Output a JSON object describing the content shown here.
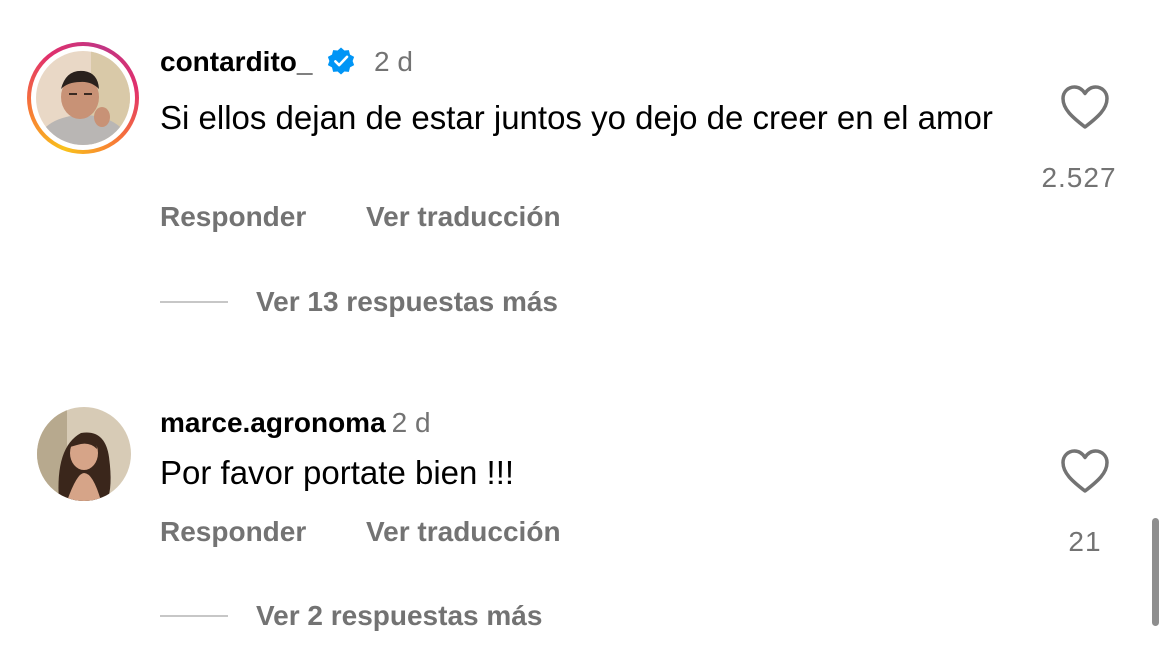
{
  "comments": [
    {
      "username": "contardito_",
      "verified": true,
      "time": "2 d",
      "text": "Si ellos dejan de estar juntos yo dejo de creer en el amor",
      "reply_label": "Responder",
      "translate_label": "Ver traducción",
      "likes": "2.527",
      "view_replies": "Ver 13 respuestas más",
      "has_story": true
    },
    {
      "username": "marce.agronoma",
      "verified": false,
      "time": "2 d",
      "text": "Por favor portate bien !!!",
      "reply_label": "Responder",
      "translate_label": "Ver traducción",
      "likes": "21",
      "view_replies": "Ver 2 respuestas más",
      "has_story": false
    }
  ],
  "colors": {
    "secondary_text": "#737373",
    "verified_badge": "#0095f6",
    "divider_line": "#c7c7c7"
  },
  "icons": [
    "heart-icon",
    "verified-badge-icon"
  ]
}
